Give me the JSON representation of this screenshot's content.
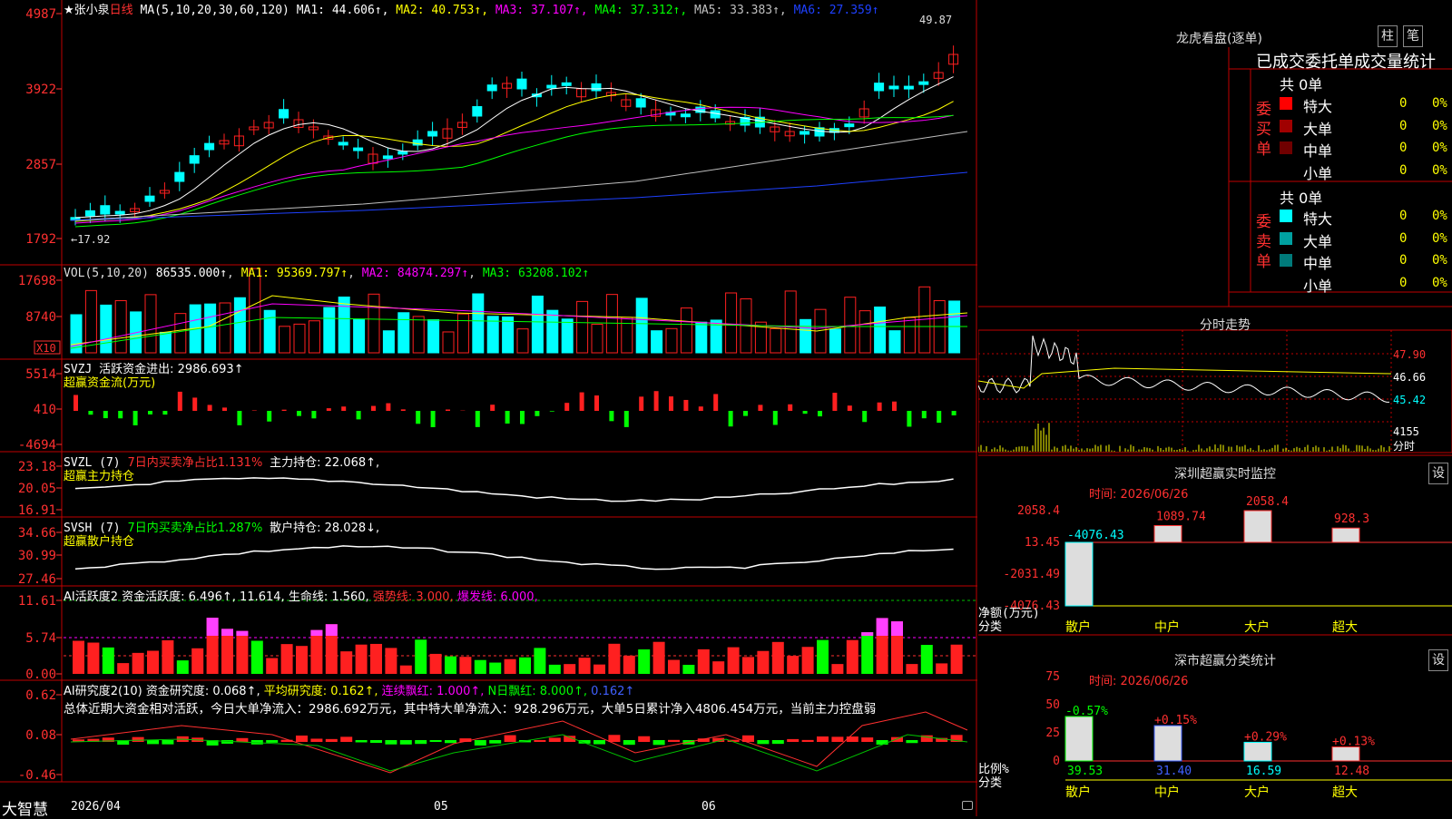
{
  "stock": {
    "name": "★张小泉",
    "period": "日线"
  },
  "main": {
    "ma_title": "MA(5,10,20,30,60,120)",
    "ma": [
      {
        "t": "MA1: 44.606↑",
        "color": "#ffffff"
      },
      {
        "t": "MA2: 40.753↑",
        "color": "#ffff00"
      },
      {
        "t": "MA3: 37.107↑",
        "color": "#ff00ff"
      },
      {
        "t": "MA4: 37.312↑",
        "color": "#00ff00"
      },
      {
        "t": "MA5: 33.383↑",
        "color": "#c0c0c0"
      },
      {
        "t": "MA6: 27.359↑",
        "color": "#1e40ff"
      }
    ],
    "yticks": [
      "4987",
      "3922",
      "2857",
      "1792"
    ],
    "high_label": "49.87",
    "low_label": "←17.92"
  },
  "vol": {
    "title": "VOL(5,10,20)",
    "value": "86535.000↑",
    "ma1": "MA1: 95369.797↑",
    "ma2": "MA2: 84874.297↑",
    "ma3": "MA3: 63208.102↑",
    "yticks": [
      "17698",
      "8740"
    ],
    "unit": "X10"
  },
  "svzj": {
    "title": "SVZJ",
    "label": "活跃资金进出: 2986.693↑",
    "sub": "超赢资金流(万元)",
    "yticks": [
      "5514",
      "410",
      "-4694"
    ]
  },
  "svzl": {
    "title": "SVZL (7)",
    "pct": "7日内买卖净占比1.131%",
    "label": "主力持仓: 22.068↑,",
    "sub": "超赢主力持仓",
    "yticks": [
      "23.18",
      "20.05",
      "16.91"
    ]
  },
  "svsh": {
    "title": "SVSH (7)",
    "pct": "7日内买卖净占比1.287%",
    "label": "散户持仓: 28.028↓,",
    "sub": "超赢散户持仓",
    "yticks": [
      "34.66",
      "30.99",
      "27.46"
    ]
  },
  "ai1": {
    "title": "AI活跃度2",
    "label": "资金活跃度: 6.496↑,",
    "v2": "11.614,",
    "life": "生命线: 1.560,",
    "strong": "强势线: 3.000,",
    "burst": "爆发线: 6.000,",
    "yticks": [
      "11.61",
      "5.74",
      "0.00"
    ]
  },
  "ai2": {
    "title": "AI研究度2(10)",
    "label": "资金研究度: 0.068↑,",
    "avg": "平均研究度: 0.162↑,",
    "streak": "连续飘红: 1.000↑,",
    "nday": "N日飘红: 8.000↑,",
    "last": "0.162↑",
    "desc": "总体近期大资金相对活跃，今日大单净流入：2986.692万元，其中特大单净流入：928.296万元，大单5日累计净入4806.454万元，当前主力控盘弱",
    "yticks": [
      "0.62",
      "0.08",
      "-0.46"
    ]
  },
  "xaxis": {
    "start": "2026/04",
    "m5": "05",
    "m6": "06"
  },
  "brand": "大智慧",
  "dragon": {
    "title": "龙虎看盘(逐单)",
    "tab1": "柱",
    "tab2": "笔",
    "header": "已成交委托单成交量统计",
    "buy": {
      "label": "委买单",
      "total": "共 0单",
      "rows": [
        {
          "name": "特大",
          "v": "0",
          "p": "0%",
          "color": "#ff0000"
        },
        {
          "name": "大单",
          "v": "0",
          "p": "0%",
          "color": "#a00000"
        },
        {
          "name": "中单",
          "v": "0",
          "p": "0%",
          "color": "#700000"
        },
        {
          "name": "小单",
          "v": "0",
          "p": "0%",
          "color": ""
        }
      ]
    },
    "sell": {
      "label": "委卖单",
      "total": "共 0单",
      "rows": [
        {
          "name": "特大",
          "v": "0",
          "p": "0%",
          "color": "#00ffff"
        },
        {
          "name": "大单",
          "v": "0",
          "p": "0%",
          "color": "#00a0a0"
        },
        {
          "name": "中单",
          "v": "0",
          "p": "0%",
          "color": "#007a7a"
        },
        {
          "name": "小单",
          "v": "0",
          "p": "0%",
          "color": ""
        }
      ]
    }
  },
  "intraday": {
    "title": "分时走势",
    "prices": [
      "47.90",
      "46.66",
      "45.42"
    ],
    "vol": "4155",
    "vol_unit": "分时"
  },
  "sz_monitor": {
    "title": "深圳超赢实时监控",
    "set": "设",
    "time": "时间: 2026/06/26",
    "yticks": [
      "2058.4",
      "13.45",
      "-2031.49",
      "-4076.43"
    ],
    "ylabel1": "净额(万元)",
    "ylabel2": "分类",
    "categories": [
      "散户",
      "中户",
      "大户",
      "超大"
    ],
    "values": [
      -4076.43,
      1089.74,
      2058.4,
      928.3
    ],
    "value_labels": [
      "-4076.43",
      "1089.74",
      "2058.4",
      "928.3"
    ]
  },
  "sz_class": {
    "title": "深市超赢分类统计",
    "set": "设",
    "time": "时间: 2026/06/26",
    "yticks": [
      "75",
      "50",
      "25",
      "0"
    ],
    "ylabel1": "比例%",
    "ylabel2": "分类",
    "categories": [
      "散户",
      "中户",
      "大户",
      "超大"
    ],
    "values": [
      39.53,
      31.4,
      16.59,
      12.48
    ],
    "changes": [
      "-0.57%",
      "+0.15%",
      "+0.29%",
      "+0.13%"
    ]
  },
  "chart_data": [
    {
      "type": "bar",
      "title": "深圳超赢实时监控",
      "xlabel": "分类",
      "ylabel": "净额(万元)",
      "categories": [
        "散户",
        "中户",
        "大户",
        "超大"
      ],
      "values": [
        -4076.43,
        1089.74,
        2058.4,
        928.3
      ],
      "ylim": [
        -4076.43,
        2058.4
      ]
    },
    {
      "type": "bar",
      "title": "深市超赢分类统计",
      "xlabel": "分类",
      "ylabel": "比例%",
      "categories": [
        "散户",
        "中户",
        "大户",
        "超大"
      ],
      "values": [
        39.53,
        31.4,
        16.59,
        12.48
      ],
      "ylim": [
        0,
        75
      ]
    }
  ],
  "colors": {
    "up": "#ff2020",
    "down": "#00ffff",
    "grid": "#c00000",
    "axis": "#ff3030"
  }
}
